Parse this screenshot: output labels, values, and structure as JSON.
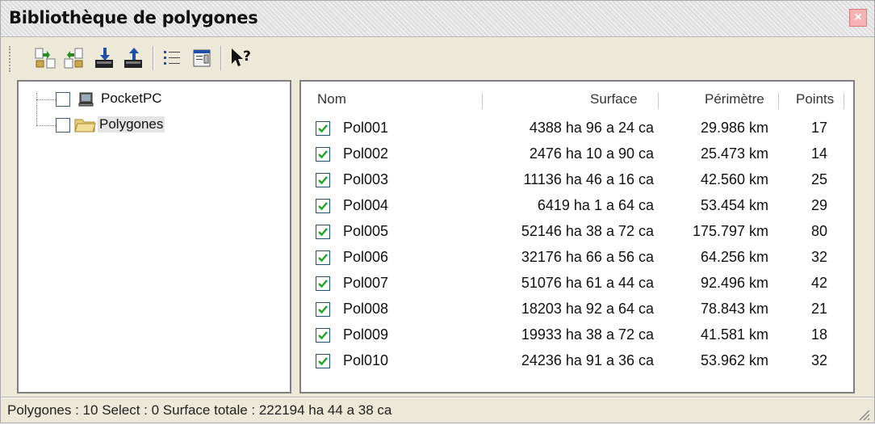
{
  "window": {
    "title": "Bibliothèque de polygones",
    "close_symbol": "×"
  },
  "toolbar": {
    "buttons": [
      "copy-to-device-icon",
      "copy-from-device-icon",
      "import-icon",
      "export-icon",
      "list-view-icon",
      "properties-icon",
      "help-pointer-icon"
    ]
  },
  "tree": {
    "items": [
      {
        "label": "PocketPC",
        "icon": "computer-icon",
        "checked": false
      },
      {
        "label": "Polygones",
        "icon": "folder-icon",
        "checked": false
      }
    ]
  },
  "table": {
    "columns": [
      "Nom",
      "Surface",
      "Périmètre",
      "Points"
    ],
    "rows": [
      {
        "name": "Pol001",
        "surface": "4388 ha 96 a 24 ca",
        "perimeter": "29.986 km",
        "points": "17",
        "checked": true
      },
      {
        "name": "Pol002",
        "surface": "2476 ha 10 a 90 ca",
        "perimeter": "25.473 km",
        "points": "14",
        "checked": true
      },
      {
        "name": "Pol003",
        "surface": "11136 ha 46 a 16 ca",
        "perimeter": "42.560 km",
        "points": "25",
        "checked": true
      },
      {
        "name": "Pol004",
        "surface": "6419 ha 1 a 64 ca",
        "perimeter": "53.454 km",
        "points": "29",
        "checked": true
      },
      {
        "name": "Pol005",
        "surface": "52146 ha 38 a 72 ca",
        "perimeter": "175.797 km",
        "points": "80",
        "checked": true
      },
      {
        "name": "Pol006",
        "surface": "32176 ha 66 a 56 ca",
        "perimeter": "64.256 km",
        "points": "32",
        "checked": true
      },
      {
        "name": "Pol007",
        "surface": "51076 ha 61 a 44 ca",
        "perimeter": "92.496 km",
        "points": "42",
        "checked": true
      },
      {
        "name": "Pol008",
        "surface": "18203 ha 92 a 64 ca",
        "perimeter": "78.843 km",
        "points": "21",
        "checked": true
      },
      {
        "name": "Pol009",
        "surface": "19933 ha 38 a 72 ca",
        "perimeter": "41.581 km",
        "points": "18",
        "checked": true
      },
      {
        "name": "Pol010",
        "surface": "24236 ha 91 a 36 ca",
        "perimeter": "53.962 km",
        "points": "32",
        "checked": true
      }
    ]
  },
  "status": {
    "text": "Polygones : 10 Select : 0 Surface totale : 222194 ha 44 a 38 ca"
  },
  "colors": {
    "checkmark": "#21a121",
    "title_bg": "#dcdcdc",
    "window_bg": "#ece9d8"
  }
}
